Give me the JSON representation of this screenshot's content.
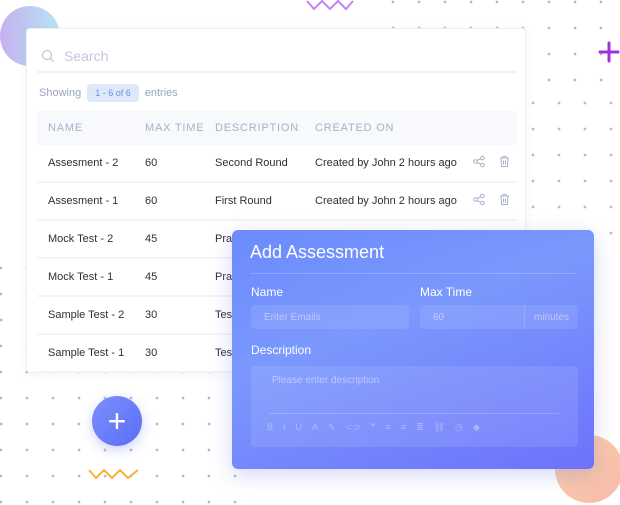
{
  "search": {
    "placeholder": "Search",
    "icon": "search-icon"
  },
  "showing": {
    "prefix": "Showing",
    "range": "1 - 6 of 6",
    "suffix": "entries"
  },
  "table": {
    "headers": [
      "NAME",
      "MAX TIME",
      "DESCRIPTION",
      "CREATED ON"
    ],
    "rows": [
      {
        "name": "Assesment - 2",
        "max_time": "60",
        "description": "Second Round",
        "created": "Created by John 2 hours ago"
      },
      {
        "name": "Assesment - 1",
        "max_time": "60",
        "description": "First Round",
        "created": "Created by John 2 hours ago"
      },
      {
        "name": "Mock Test - 2",
        "max_time": "45",
        "description": "Prac",
        "created": ""
      },
      {
        "name": "Mock Test - 1",
        "max_time": "45",
        "description": "Prac",
        "created": ""
      },
      {
        "name": "Sample Test - 2",
        "max_time": "30",
        "description": "Tes",
        "created": ""
      },
      {
        "name": "Sample Test - 1",
        "max_time": "30",
        "description": "Tes",
        "created": ""
      }
    ]
  },
  "modal": {
    "title": "Add Assessment",
    "name_label": "Name",
    "name_placeholder": "Enter Emails",
    "max_time_label": "Max Time",
    "max_time_value": "60",
    "max_time_unit": "minutes",
    "description_label": "Description",
    "description_placeholder": "Please enter description",
    "toolbar": [
      "B",
      "I",
      "U",
      "A",
      "✎",
      "⊂⊃",
      "❞",
      "≡",
      "≡",
      "≣",
      "⛓",
      "◷",
      "◆"
    ]
  },
  "add_button": {
    "label": "+"
  },
  "colors": {
    "accent": "#6b8bfd",
    "badge_bg": "#dde8fb",
    "plus_mark": "#a230d8"
  }
}
